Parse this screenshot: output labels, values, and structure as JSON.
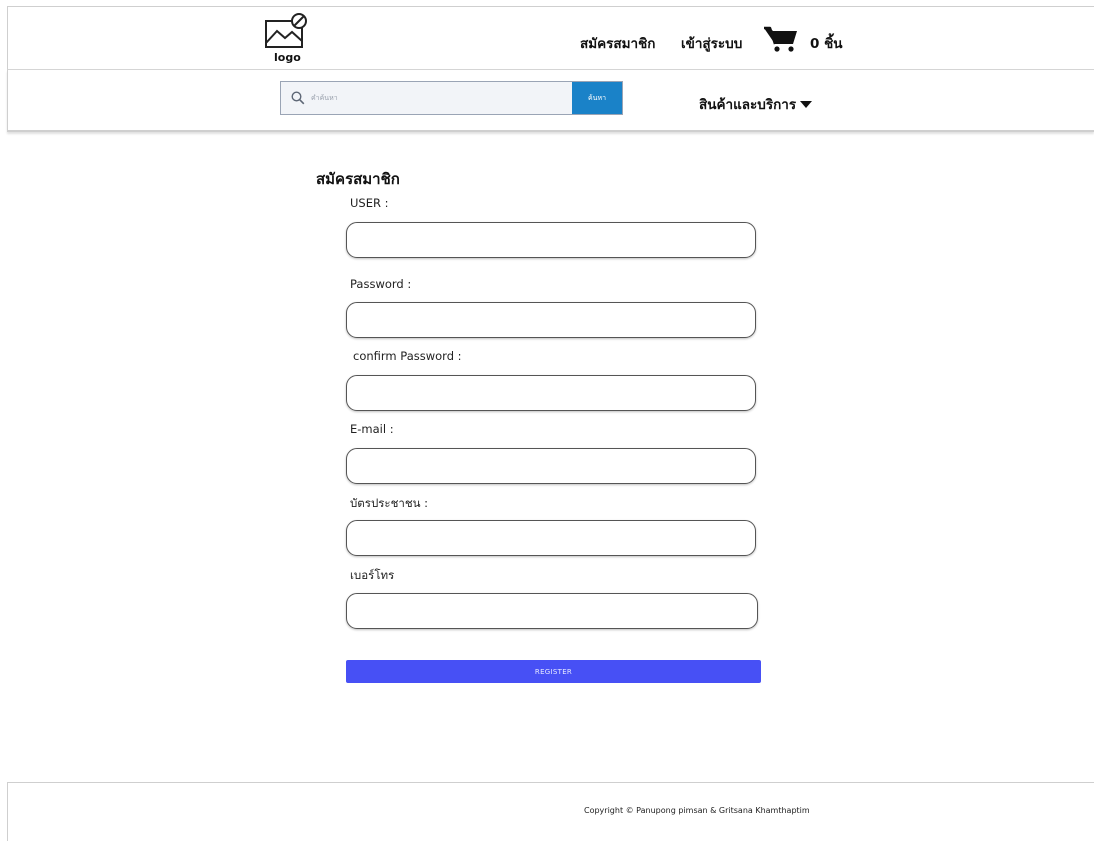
{
  "header": {
    "logo_label": "logo",
    "nav_register": "สมัครสมาชิก",
    "nav_login": "เข้าสู่ระบบ",
    "cart_count": "0 ชิ้น"
  },
  "search": {
    "placeholder": "คำค้นหา",
    "button_label": "ค้นหา",
    "categories_label": "สินค้าและบริการ"
  },
  "form": {
    "title": "สมัครสมาชิก",
    "user_label": "USER :",
    "user_value": "",
    "password_label": "Password :",
    "password_value": "",
    "confirm_label": "confirm  Password :",
    "confirm_value": "",
    "email_label": "E-mail :",
    "email_value": "",
    "idcard_label": "บัตรประชาชน :",
    "idcard_value": "",
    "phone_label": "เบอร์โทร",
    "phone_value": "",
    "register_label": "REGISTER"
  },
  "footer": {
    "copyright": "Copyright © Panupong pimsan & Gritsana Khamthaptim"
  },
  "colors": {
    "search_button": "#1a82c8",
    "register_button": "#4750f5"
  },
  "icons": [
    "image-placeholder-icon",
    "cart-icon",
    "search-icon",
    "caret-down-icon"
  ]
}
